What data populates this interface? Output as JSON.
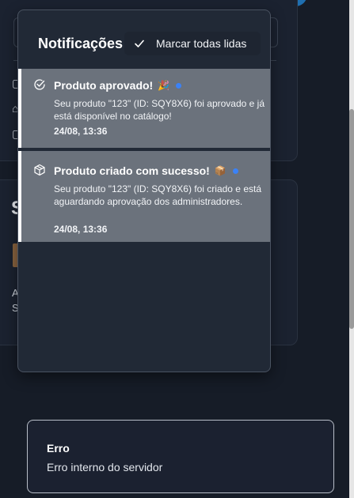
{
  "notifications_panel": {
    "title": "Notificações",
    "mark_all_read_label": "Marcar todas lidas",
    "items": [
      {
        "icon": "check-circle-icon",
        "title": "Produto aprovado!",
        "emoji": "🎉",
        "unread": true,
        "body": "Seu produto \"123\" (ID: SQY8X6) foi aprovado e já está disponível no catálogo!",
        "timestamp": "24/08, 13:36"
      },
      {
        "icon": "package-icon",
        "title": "Produto criado com sucesso!",
        "emoji": "📦",
        "unread": true,
        "body": "Seu produto \"123\" (ID: SQY8X6) foi criado e está aguardando aprovação dos administradores.",
        "timestamp": "24/08, 13:36"
      }
    ]
  },
  "background": {
    "section_heading_fragment": "S",
    "text_fragment_1": "A",
    "text_fragment_2": "S"
  },
  "toast": {
    "title": "Erro",
    "message": "Erro interno do servidor"
  },
  "colors": {
    "page_bg": "#161c27",
    "panel_bg": "#212936",
    "notification_bg": "#6b727c",
    "unread_dot": "#3b82f6"
  }
}
